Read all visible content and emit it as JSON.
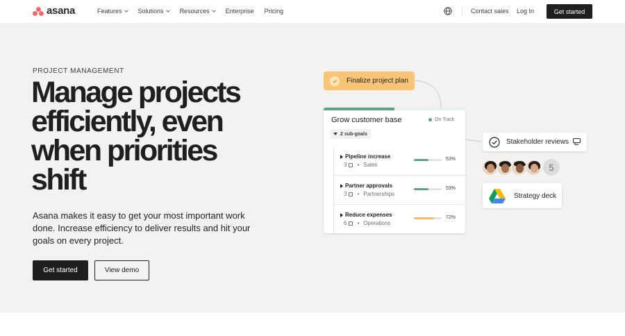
{
  "nav": {
    "brand": "asana",
    "links": [
      {
        "label": "Features",
        "dropdown": true
      },
      {
        "label": "Solutions",
        "dropdown": true
      },
      {
        "label": "Resources",
        "dropdown": true
      },
      {
        "label": "Enterprise",
        "dropdown": false
      },
      {
        "label": "Pricing",
        "dropdown": false
      }
    ],
    "globe_icon": "globe-icon",
    "contact_sales": "Contact sales",
    "log_in": "Log In",
    "cta": "Get started"
  },
  "hero": {
    "eyebrow": "PROJECT MANAGEMENT",
    "headline": "Manage projects efficiently, even when priorities shift",
    "subcopy": "Asana makes it easy to get your most important work done. Increase efficiency to deliver results and hit your goals on every project.",
    "primary_cta": "Get started",
    "secondary_cta": "View demo"
  },
  "illustration": {
    "task_chip": {
      "label": "Finalize project plan",
      "color": "#f8c576"
    },
    "goal_card": {
      "title": "Grow customer base",
      "status": "On Track",
      "progress": 0.5,
      "subgoals_label": "2 sub-goals",
      "subgoals": [
        {
          "name": "Pipeline increase",
          "count": "3",
          "team": "Sales",
          "percent": "53%",
          "progress": 0.53,
          "color": "#5da283"
        },
        {
          "name": "Partner approvals",
          "count": "3",
          "team": "Partnerships",
          "percent": "53%",
          "progress": 0.53,
          "color": "#5da283"
        },
        {
          "name": "Reduce expenses",
          "count": "6",
          "team": "Operations",
          "percent": "72%",
          "progress": 0.72,
          "color": "#f1bd6c"
        }
      ]
    },
    "stakeholder_card": {
      "label": "Stakeholder reviews"
    },
    "avatars": {
      "extra_count": "5"
    },
    "deck_card": {
      "label": "Strategy deck"
    }
  },
  "colors": {
    "brand": "#f06a6a",
    "dark": "#1e1f21",
    "hero_bg": "#f3f2f1",
    "on_track": "#5da283"
  }
}
